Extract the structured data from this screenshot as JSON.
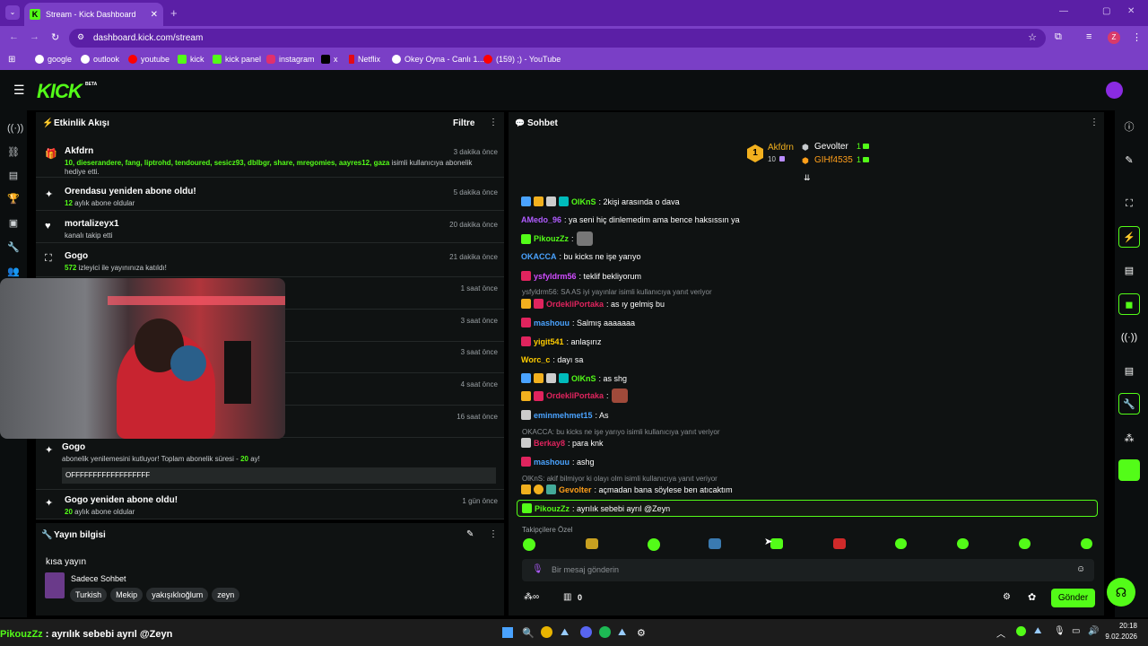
{
  "browser": {
    "tab_title": "Stream - Kick Dashboard",
    "url": "dashboard.kick.com/stream",
    "profile_initial": "Z",
    "bookmarks": [
      {
        "label": "google",
        "color": "#ffffff"
      },
      {
        "label": "outlook",
        "color": "#ffffff"
      },
      {
        "label": "youtube",
        "color": "#ff0000"
      },
      {
        "label": "kick",
        "color": "#53fc18"
      },
      {
        "label": "kick panel",
        "color": "#53fc18"
      },
      {
        "label": "instagram",
        "color": "#e1306c"
      },
      {
        "label": "x",
        "color": "#000000"
      },
      {
        "label": "Netflix",
        "color": "#e50914"
      },
      {
        "label": "Okey Oyna - Canlı 1...",
        "color": "#ffffff"
      },
      {
        "label": "(159) ;) - YouTube",
        "color": "#ff0000"
      }
    ]
  },
  "header": {
    "logo": "KICK",
    "beta": "BETA"
  },
  "activity": {
    "title": "Etkinlik Akışı",
    "filter": "Filtre",
    "events": [
      {
        "name": "Akfdrn",
        "time": "3 dakika önce",
        "desc_green": "10, dieserandere, fang, liptrohd, tendoured, sesicz93, dblbgr, share, mregomies, aayres12, gaza",
        "desc": " isimli kullanıcıya abonelik hediye etti."
      },
      {
        "name": "Orendasu yeniden abone oldu!",
        "time": "5 dakika önce",
        "desc_green": "12",
        "desc": " aylık abone oldular"
      },
      {
        "name": "mortalizeyx1",
        "time": "20 dakika önce",
        "desc_green": "",
        "desc": "kanalı takip etti"
      },
      {
        "name": "Gogo",
        "time": "21 dakika önce",
        "desc_green": "572",
        "desc": " izleyici ile yayınınıza katıldı!"
      },
      {
        "time": "1 saat önce"
      },
      {
        "time": "3 saat önce"
      },
      {
        "time": "3 saat önce"
      },
      {
        "time": "4 saat önce"
      },
      {
        "time": "16 saat önce"
      },
      {
        "name": "Gogo",
        "time": "1 gün önce",
        "desc": "abonelik yenilemesini kutluyor! Toplam abonelik süresi - ",
        "desc_green": "20",
        "desc_end": " ay!",
        "message": "OFFFFFFFFFFFFFFFFFF"
      },
      {
        "name": "Gogo yeniden abone oldu!",
        "time": "1 gün önce",
        "desc_green": "20",
        "desc": " aylık abone oldular"
      }
    ]
  },
  "stream_info": {
    "title": "Yayın bilgisi",
    "stream_title": "kısa yayın",
    "category": "Sadece Sohbet",
    "tags": [
      "Turkish",
      "Mekip",
      "yakışıklıoğlum",
      "zeyn"
    ]
  },
  "chat": {
    "title": "Sohbet",
    "leaderboard": {
      "first_name": "Akfdrn",
      "first_count": "10",
      "second_name": "Gevolter",
      "second_count": "1",
      "third_name": "GIHf4535",
      "third_count": "1",
      "rank": "1"
    },
    "messages": [
      {
        "user": "OlKnS",
        "color": "#53fc18",
        "text": ": 2kişi arasında o dava"
      },
      {
        "user": "AMedo_96",
        "color": "#b05cff",
        "text": ": ya seni hiç dinlemedim ama bence haksıssın ya"
      },
      {
        "user": "PikouzZz",
        "color": "#53fc18",
        "text": ":"
      },
      {
        "user": "OKACCA",
        "color": "#4aa3ff",
        "text": ": bu kicks ne işe yarıyo"
      },
      {
        "user": "ysfyldrm56",
        "color": "#d04cff",
        "text": ": teklif bekliyorum"
      },
      {
        "reply": "ysfyldrm56: SA AS  iyi yayınlar isimli kullanıcıya yanıt veriyor"
      },
      {
        "user": "OrdekliPortaka",
        "color": "#e0245e",
        "text": ": as ıy gelmiş bu"
      },
      {
        "user": "mashouu",
        "color": "#4aa3ff",
        "text": ": Salmış aaaaaaa"
      },
      {
        "user": "yigit541",
        "color": "#ffcc00",
        "text": ": anlaşırız"
      },
      {
        "user": "Worc_c",
        "color": "#ffcc00",
        "text": ": dayı sa"
      },
      {
        "user": "OlKnS",
        "color": "#53fc18",
        "text": ": as shg"
      },
      {
        "user": "OrdekliPortaka",
        "color": "#e0245e",
        "text": ":"
      },
      {
        "user": "eminmehmet15",
        "color": "#4aa3ff",
        "text": ": As"
      },
      {
        "reply": "OKACCA: bu kicks ne işe yarıyo isimli kullanıcıya yanıt veriyor"
      },
      {
        "user": "Berkay8",
        "color": "#e0245e",
        "text": ": para knk"
      },
      {
        "user": "mashouu",
        "color": "#4aa3ff",
        "text": ": ashg"
      },
      {
        "reply": "OlKnS: akif bilmiyor ki olayı olm isimli kullanıcıya yanıt veriyor"
      },
      {
        "user": "Gevolter",
        "color": "#ff9f1a",
        "text": ": açmadan bana söylese ben atıcaktım"
      }
    ],
    "highlight": {
      "user": "PikouzZz",
      "text": ": ayrılık sebebi ayrıl @Zeyn"
    },
    "emote_label": "Takipçilere Özel",
    "input_placeholder": "Bir mesaj gönderin",
    "points": "0",
    "send": "Gönder"
  },
  "overlay_text": {
    "user": "PikouzZz",
    "text": " : ayrılık sebebi ayrıl @Zeyn"
  },
  "taskbar": {
    "time": "20:18",
    "date": "9.02.2026"
  }
}
